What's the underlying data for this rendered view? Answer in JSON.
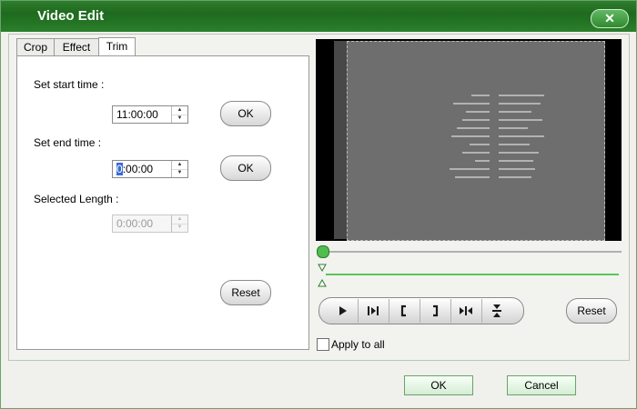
{
  "window": {
    "title": "Video Edit",
    "close_glyph": "✕"
  },
  "tabs": [
    {
      "label": "Crop"
    },
    {
      "label": "Effect"
    },
    {
      "label": "Trim",
      "active": true
    }
  ],
  "trim": {
    "start_label": "Set start time :",
    "start_value": "11:00:00",
    "start_ok": "OK",
    "end_label": "Set end time :",
    "end_value_selected": "0",
    "end_value_rest": ":00:00",
    "end_ok": "OK",
    "length_label": "Selected Length :",
    "length_value": "0:00:00",
    "reset_label": "Reset"
  },
  "player": {
    "controls": [
      {
        "name": "play-icon"
      },
      {
        "name": "preview-selection-icon"
      },
      {
        "name": "set-start-icon"
      },
      {
        "name": "set-end-icon"
      },
      {
        "name": "fit-selection-icon"
      },
      {
        "name": "center-marker-icon"
      }
    ],
    "reset_label": "Reset",
    "apply_all_label": "Apply to all",
    "apply_all_checked": false
  },
  "footer": {
    "ok_label": "OK",
    "cancel_label": "Cancel"
  },
  "colors": {
    "accent": "#1e6a1e",
    "range": "#59c759"
  }
}
